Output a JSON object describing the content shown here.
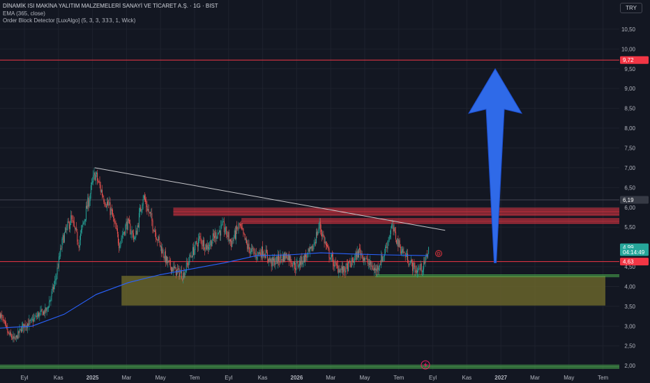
{
  "legend": {
    "title": "DİNAMİK ISI MAKİNA YALITIM MALZEMELERİ SANAYİ VE TİCARET A.Ş. · 1G · BIST",
    "ema": "EMA (365, close)",
    "indicator": "Order Block Detector [LuxAlgo] (5, 3, 3, 𝟥𝟥𝟥, 1, Wick)"
  },
  "currency": "TRY",
  "colors": {
    "background": "#131722",
    "up": "#26a69a",
    "down": "#ef5350",
    "ema": "#2962ff",
    "bear_block": "#f23645",
    "bull_block": "#4caf50",
    "demand_zone": "#6f6a2c",
    "arrow": "#2f6ae8",
    "trendline": "#c8c8cc"
  },
  "chart_data": {
    "type": "candlestick",
    "price_scale": {
      "ylim": [
        1.88,
        10.85
      ],
      "ticks": [
        "10,50",
        "10,00",
        "9,50",
        "9,00",
        "8,50",
        "8,00",
        "7,50",
        "7,00",
        "6,50",
        "6,00",
        "5,50",
        "4,50",
        "4,00",
        "3,50",
        "3,00",
        "2,50",
        "2,00"
      ],
      "labels": [
        {
          "text": "9,72",
          "value": 9.72,
          "color": "#f23645"
        },
        {
          "text": "6,19",
          "value": 6.19,
          "color": "#363a45"
        },
        {
          "text": "4,99",
          "value": 4.99,
          "color": "#26a69a"
        },
        {
          "text": "04:14:49",
          "value": 4.87,
          "color": "#26a69a"
        },
        {
          "text": "4,63",
          "value": 4.63,
          "color": "#f23645"
        }
      ]
    },
    "time_axis": {
      "ticks": [
        "Eyl",
        "Kas",
        "2025",
        "Mar",
        "May",
        "Tem",
        "Eyl",
        "Kas",
        "2026",
        "Mar",
        "May",
        "Tem",
        "Eyl",
        "Kas",
        "2027",
        "Mar",
        "May",
        "Tem"
      ],
      "bold": [
        "2025",
        "2026",
        "2027"
      ]
    },
    "anchors": [
      {
        "i": 0,
        "price": 3.3
      },
      {
        "i": 10,
        "price": 2.8
      },
      {
        "i": 18,
        "price": 2.65
      },
      {
        "i": 28,
        "price": 3.0
      },
      {
        "i": 38,
        "price": 3.1
      },
      {
        "i": 48,
        "price": 3.3
      },
      {
        "i": 58,
        "price": 3.4
      },
      {
        "i": 68,
        "price": 4.1
      },
      {
        "i": 78,
        "price": 5.2
      },
      {
        "i": 88,
        "price": 5.7
      },
      {
        "i": 98,
        "price": 5.1
      },
      {
        "i": 108,
        "price": 6.0
      },
      {
        "i": 118,
        "price": 6.85
      },
      {
        "i": 128,
        "price": 6.3
      },
      {
        "i": 138,
        "price": 5.9
      },
      {
        "i": 148,
        "price": 5.1
      },
      {
        "i": 158,
        "price": 5.6
      },
      {
        "i": 168,
        "price": 5.2
      },
      {
        "i": 178,
        "price": 6.3
      },
      {
        "i": 188,
        "price": 5.7
      },
      {
        "i": 198,
        "price": 5.1
      },
      {
        "i": 208,
        "price": 4.6
      },
      {
        "i": 218,
        "price": 4.4
      },
      {
        "i": 228,
        "price": 4.3
      },
      {
        "i": 238,
        "price": 4.8
      },
      {
        "i": 248,
        "price": 5.2
      },
      {
        "i": 258,
        "price": 5.0
      },
      {
        "i": 268,
        "price": 5.3
      },
      {
        "i": 278,
        "price": 5.5
      },
      {
        "i": 288,
        "price": 5.1
      },
      {
        "i": 298,
        "price": 5.55
      },
      {
        "i": 308,
        "price": 5.0
      },
      {
        "i": 318,
        "price": 4.8
      },
      {
        "i": 328,
        "price": 4.9
      },
      {
        "i": 338,
        "price": 4.6
      },
      {
        "i": 348,
        "price": 4.7
      },
      {
        "i": 358,
        "price": 4.8
      },
      {
        "i": 368,
        "price": 4.5
      },
      {
        "i": 378,
        "price": 4.7
      },
      {
        "i": 388,
        "price": 4.9
      },
      {
        "i": 398,
        "price": 5.55
      },
      {
        "i": 408,
        "price": 4.9
      },
      {
        "i": 418,
        "price": 4.5
      },
      {
        "i": 428,
        "price": 4.4
      },
      {
        "i": 438,
        "price": 4.6
      },
      {
        "i": 448,
        "price": 4.9
      },
      {
        "i": 458,
        "price": 4.6
      },
      {
        "i": 468,
        "price": 4.4
      },
      {
        "i": 478,
        "price": 4.8
      },
      {
        "i": 488,
        "price": 5.5
      },
      {
        "i": 498,
        "price": 5.0
      },
      {
        "i": 508,
        "price": 4.7
      },
      {
        "i": 518,
        "price": 4.4
      },
      {
        "i": 528,
        "price": 4.5
      },
      {
        "i": 534,
        "price": 4.99
      }
    ],
    "ema_points": [
      {
        "i": 0,
        "price": 2.95
      },
      {
        "i": 40,
        "price": 3.0
      },
      {
        "i": 80,
        "price": 3.3
      },
      {
        "i": 120,
        "price": 3.8
      },
      {
        "i": 160,
        "price": 4.1
      },
      {
        "i": 200,
        "price": 4.3
      },
      {
        "i": 240,
        "price": 4.45
      },
      {
        "i": 280,
        "price": 4.6
      },
      {
        "i": 320,
        "price": 4.78
      },
      {
        "i": 360,
        "price": 4.8
      },
      {
        "i": 400,
        "price": 4.85
      },
      {
        "i": 440,
        "price": 4.82
      },
      {
        "i": 480,
        "price": 4.8
      },
      {
        "i": 534,
        "price": 4.78
      }
    ],
    "horizontal_lines": [
      {
        "price": 9.72,
        "color": "#f23645"
      },
      {
        "price": 6.19,
        "color": "#434651"
      },
      {
        "price": 4.63,
        "color": "#f23645"
      }
    ],
    "trendline": {
      "from": {
        "i": 118,
        "price": 7.0
      },
      "to": {
        "i": 555,
        "price": 5.42
      }
    },
    "order_blocks": [
      {
        "kind": "bearish",
        "start_i": 190,
        "top": 5.98,
        "bottom": 5.78
      },
      {
        "kind": "bearish",
        "start_i": 275,
        "top": 5.72,
        "bottom": 5.58
      },
      {
        "kind": "bullish",
        "start_i": 468,
        "top": 4.3,
        "bottom": 4.23
      },
      {
        "kind": "bullish",
        "start_i": 0,
        "top": 2.02,
        "bottom": 1.92
      }
    ],
    "demand_zone": {
      "start_i": 135,
      "end_i": 760,
      "top": 4.27,
      "bottom": 3.52
    },
    "arrow": {
      "i": 617,
      "from": 4.6,
      "to": 9.5
    },
    "marker": {
      "text": "D",
      "i": 540,
      "price": 4.64
    }
  }
}
